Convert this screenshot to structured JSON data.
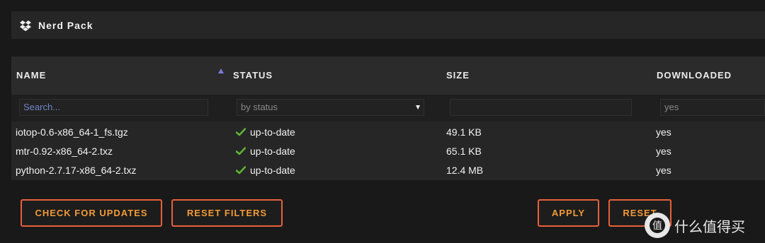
{
  "plugin": {
    "title": "Nerd Pack",
    "icon": "dropbox-icon"
  },
  "table": {
    "columns": [
      "NAME",
      "STATUS",
      "SIZE",
      "DOWNLOADED"
    ],
    "sort_column": "NAME",
    "sort_direction": "ascending",
    "filters": {
      "name_placeholder": "Search...",
      "status_selected": "by status",
      "size_value": "",
      "downloaded_value": "yes"
    },
    "rows": [
      {
        "name": "iotop-0.6-x86_64-1_fs.tgz",
        "status": "up-to-date",
        "size": "49.1 KB",
        "downloaded": "yes"
      },
      {
        "name": "mtr-0.92-x86_64-2.txz",
        "status": "up-to-date",
        "size": "65.1 KB",
        "downloaded": "yes"
      },
      {
        "name": "python-2.7.17-x86_64-2.txz",
        "status": "up-to-date",
        "size": "12.4 MB",
        "downloaded": "yes"
      }
    ]
  },
  "buttons": {
    "check_updates": "CHECK FOR UPDATES",
    "reset_filters": "RESET FILTERS",
    "apply": "APPLY",
    "reset": "RESET"
  },
  "watermark": {
    "text": "什么值得买",
    "logo_char": "值"
  },
  "colors": {
    "background": "#191919",
    "panel": "#262626",
    "accent_border": "#e8603a",
    "accent_text": "#f29a37",
    "status_ok": "#5fb336",
    "sort_arrow": "#7b7bdc"
  }
}
